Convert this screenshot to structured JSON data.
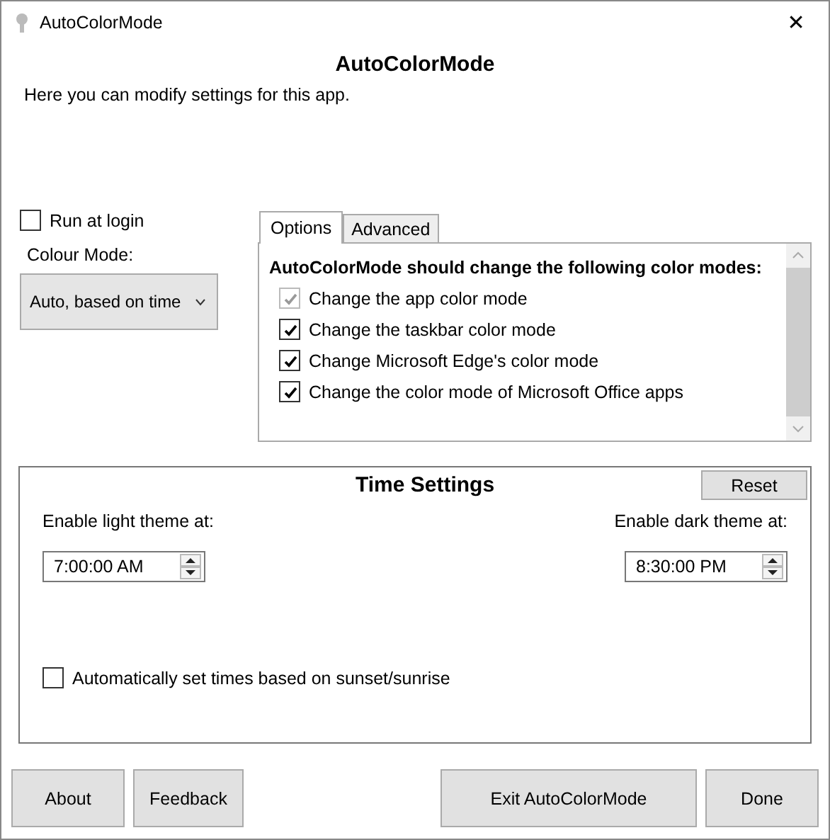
{
  "window": {
    "title": "AutoColorMode",
    "close": "✕"
  },
  "heading": "AutoColorMode",
  "description": "Here you can modify settings for this app.",
  "run_at_login": {
    "label": "Run at login",
    "checked": false
  },
  "colour_mode": {
    "label": "Colour Mode:",
    "value": "Auto, based on time"
  },
  "tabs": [
    {
      "label": "Options",
      "selected": true
    },
    {
      "label": "Advanced",
      "selected": false
    }
  ],
  "options": {
    "title": "AutoColorMode should change the following color modes:",
    "items": [
      {
        "label": "Change the app color mode",
        "checked": true,
        "disabled": true
      },
      {
        "label": "Change the taskbar color mode",
        "checked": true,
        "disabled": false
      },
      {
        "label": "Change Microsoft Edge's color mode",
        "checked": true,
        "disabled": false
      },
      {
        "label": "Change the color mode of Microsoft Office apps",
        "checked": true,
        "disabled": false
      }
    ]
  },
  "time_settings": {
    "title": "Time Settings",
    "reset": "Reset",
    "light": {
      "label": "Enable light theme at:",
      "value": "7:00:00 AM"
    },
    "dark": {
      "label": "Enable dark theme at:",
      "value": "8:30:00 PM"
    },
    "auto_sun": {
      "label": "Automatically set times based on sunset/sunrise",
      "checked": false
    }
  },
  "buttons": [
    {
      "label": "About"
    },
    {
      "label": "Feedback"
    },
    {
      "label": "Exit AutoColorMode"
    },
    {
      "label": "Done"
    }
  ]
}
